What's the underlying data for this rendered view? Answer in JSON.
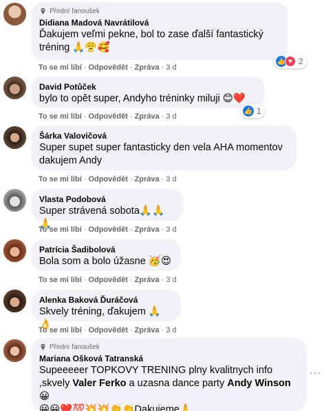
{
  "comments": [
    {
      "badge": "Přední fanoušek",
      "author": "Didiana Madová Navrátilová",
      "text_line1": "Ďakujem veľmi pekne, bol to zase ďalší fantastický",
      "text_line2": "tréning 🙏😤🥰",
      "actions": {
        "like": "To se mi líbí",
        "reply": "Odpovědět",
        "message": "Zpráva",
        "time": "3 d"
      },
      "reactions": {
        "count": "2",
        "types": [
          "like-icon",
          "love-icon"
        ]
      }
    },
    {
      "author": "David Potůček",
      "text_line1": "bylo to opět super, Andyho tréninky miluji 😊❤️",
      "actions": {
        "like": "To se mi líbí",
        "reply": "Odpovědět",
        "message": "Zpráva",
        "time": "3 d"
      },
      "reactions": {
        "count": "1",
        "types": [
          "like-icon"
        ]
      }
    },
    {
      "author": "Šárka Valovičová",
      "text_line1": "Super supet super fantasticky den vela AHA momentov",
      "text_line2": "dakujem Andy",
      "actions": {
        "like": "To se mi líbí",
        "reply": "Odpovědět",
        "message": "Zpráva",
        "time": "3 d"
      }
    },
    {
      "author": "Vlasta Podobová",
      "text_line1": "Super strávená sobota🙏🙏🙏",
      "actions": {
        "like": "To se mi líbí",
        "reply": "Odpovědět",
        "message": "Zpráva",
        "time": "3 d"
      }
    },
    {
      "author": "Patrícia Šadibolová",
      "text_line1": "Bola som a bolo úžasne 🥳😍",
      "actions": {
        "like": "To se mi líbí",
        "reply": "Odpovědět",
        "message": "Zpráva",
        "time": "3 d"
      }
    },
    {
      "author": "Alenka Baková Ďuráčová",
      "text_line1": "Skvely tréning, ďakujem 🙏👌",
      "actions": {
        "like": "To se mi líbí",
        "reply": "Odpovědět",
        "message": "Zpráva",
        "time": "3 d"
      }
    },
    {
      "badge": "Přední fanoušek",
      "author": "Mariana Ošková Tatranská",
      "text_line1": "Supeeeeer TOPKOVY TRENING plny kvalitnych info",
      "text_line2_pre": ",skvely ",
      "mention1": "Valer Ferko",
      "text_line2_mid": " a uzasna dance party ",
      "mention2": "Andy Winson",
      "text_line2_post": "😀",
      "text_line3": "😀😀❤️💯💥💥👏👏Dakujeme🙏"
    }
  ],
  "more_icon": "more-options-icon",
  "colors": {
    "bubble": "#f0f2f5",
    "meta": "#65676b",
    "like": "#1877f2",
    "love": "#f33e58"
  }
}
